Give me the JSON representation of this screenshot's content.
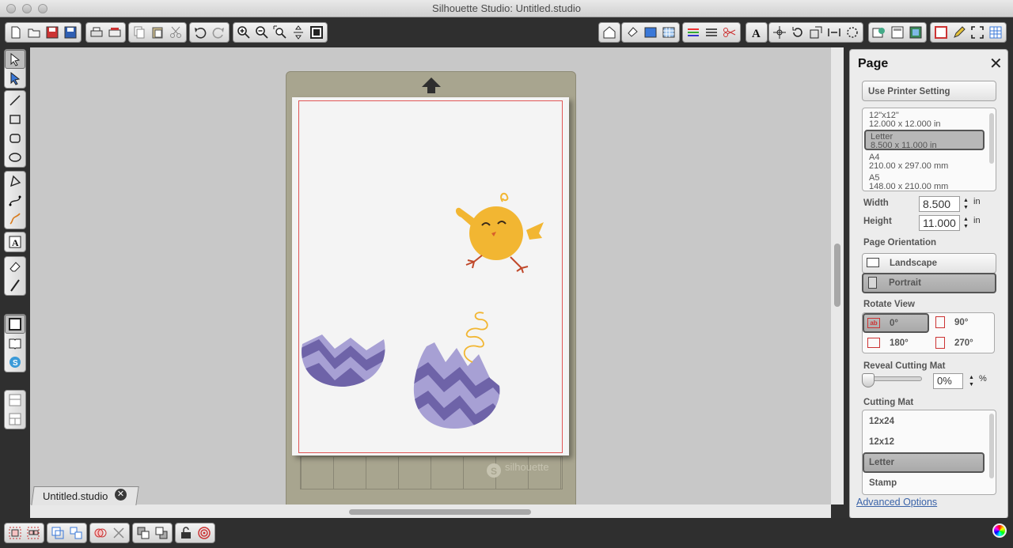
{
  "window": {
    "title": "Silhouette Studio: Untitled.studio"
  },
  "document_tab": {
    "label": "Untitled.studio",
    "close": "✕"
  },
  "mat": {
    "brand": "silhouette"
  },
  "panel": {
    "title": "Page",
    "close": "✕",
    "use_printer": "Use Printer Setting",
    "page_sizes": [
      {
        "name": "12\"x12\"",
        "dims": "12.000 x 12.000 in"
      },
      {
        "name": "Letter",
        "dims": "8.500 x 11.000 in"
      },
      {
        "name": "A4",
        "dims": "210.00 x 297.00 mm"
      },
      {
        "name": "A5",
        "dims": "148.00 x 210.00 mm"
      }
    ],
    "selected_page_size": "Letter",
    "width_label": "Width",
    "width_value": "8.500",
    "height_label": "Height",
    "height_value": "11.000",
    "unit": "in",
    "orientation_label": "Page Orientation",
    "orientation_landscape": "Landscape",
    "orientation_portrait": "Portrait",
    "orientation_selected": "Portrait",
    "rotate_label": "Rotate View",
    "rotate_0": "0°",
    "rotate_90": "90°",
    "rotate_180": "180°",
    "rotate_270": "270°",
    "rotate_selected": "0°",
    "reveal_label": "Reveal Cutting Mat",
    "reveal_value": "0%",
    "reveal_level": 0,
    "reveal_unit": "%",
    "cutting_mat_label": "Cutting Mat",
    "cutting_mats": [
      "12x24",
      "12x12",
      "Letter",
      "Stamp"
    ],
    "cutting_mat_selected": "Letter",
    "advanced": "Advanced Options"
  },
  "colors": {
    "accent": "#f2b632",
    "egg_light": "#a7a0d4",
    "egg_dark": "#6e63a8",
    "cut_line": "#e05555"
  }
}
